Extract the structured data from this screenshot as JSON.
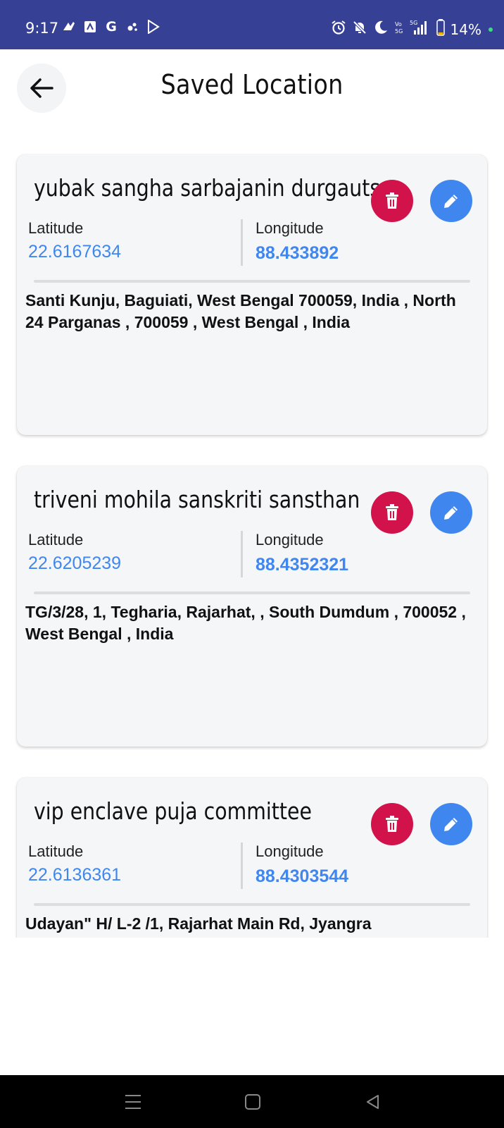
{
  "status_bar": {
    "time": "9:17",
    "battery": "14%",
    "left_icons": [
      "app-icon",
      "app-icon",
      "google-icon",
      "app-icon",
      "play-store-icon"
    ],
    "right_icons": [
      "alarm-icon",
      "mute-icon",
      "moon-icon",
      "volte-icon",
      "signal-5g-icon",
      "battery-icon"
    ],
    "bg_color": "#364094"
  },
  "header": {
    "title": "Saved Location",
    "back_icon": "arrow-left-icon"
  },
  "locations": [
    {
      "name": "yubak sangha sarbajanin durgautsav committee",
      "latitude_label": "Latitude",
      "latitude": "22.6167634",
      "longitude_label": "Longitude",
      "longitude": "88.433892",
      "address": "Santi Kunju, Baguiati, West Bengal 700059, India , North 24 Parganas , 700059 , West Bengal , India"
    },
    {
      "name": "triveni mohila sanskriti sansthan",
      "latitude_label": "Latitude",
      "latitude": "22.6205239",
      "longitude_label": "Longitude",
      "longitude": "88.4352321",
      "address": "TG/3/28, 1, Tegharia, Rajarhat,  , South Dumdum , 700052 , West Bengal , India"
    },
    {
      "name": "vip enclave puja committee",
      "latitude_label": "Latitude",
      "latitude": "22.6136361",
      "longitude_label": "Longitude",
      "longitude": "88.4303544",
      "address": "Udayan\" H/ L-2 /1, Rajarhat Main Rd, Jyangra"
    }
  ],
  "colors": {
    "delete": "#d2124a",
    "edit": "#3f87ef",
    "value": "#3f87ef",
    "card_bg": "#f5f6f8"
  },
  "nav": {
    "icons": [
      "menu-icon",
      "home-icon",
      "back-icon"
    ]
  }
}
